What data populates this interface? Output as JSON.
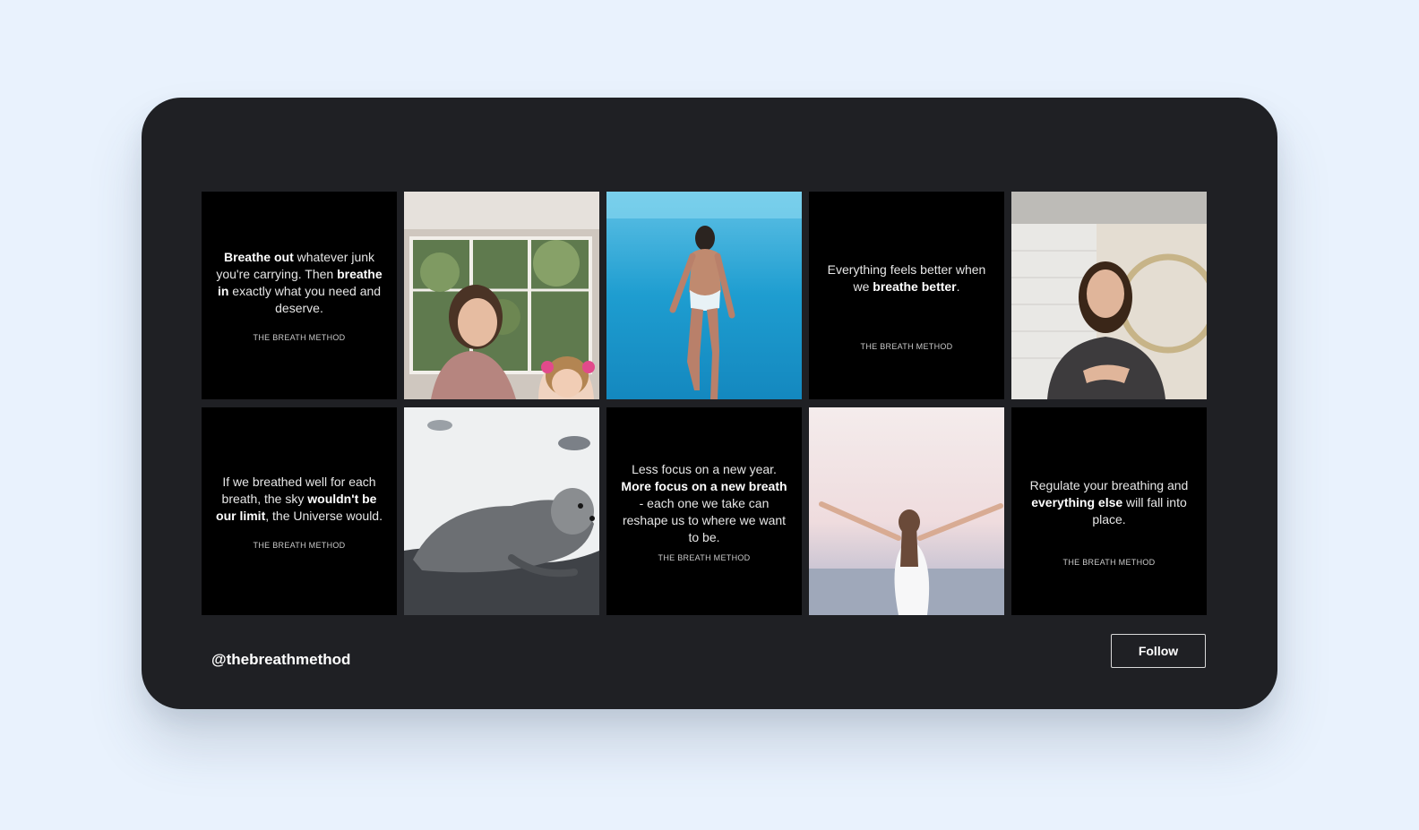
{
  "feed": {
    "handle": "@thebreathmethod",
    "follow_label": "Follow",
    "signature": "THE BREATH METHOD"
  },
  "tiles": [
    {
      "kind": "quote",
      "segments": [
        {
          "t": "Breathe out",
          "b": true
        },
        {
          "t": " whatever junk you're carrying. Then ",
          "b": false
        },
        {
          "t": "breathe in",
          "b": true
        },
        {
          "t": " exactly what you need and deserve.",
          "b": false
        }
      ]
    },
    {
      "kind": "photo",
      "subject": "woman-and-child-photo"
    },
    {
      "kind": "photo",
      "subject": "underwater-swimmer-photo"
    },
    {
      "kind": "quote",
      "segments": [
        {
          "t": "Everything feels better when we ",
          "b": false
        },
        {
          "t": "breathe better",
          "b": true
        },
        {
          "t": ".",
          "b": false
        }
      ]
    },
    {
      "kind": "photo",
      "subject": "woman-hand-on-chest-photo"
    },
    {
      "kind": "quote",
      "segments": [
        {
          "t": "If we breathed well for each breath, the sky ",
          "b": false
        },
        {
          "t": "wouldn't be our limit",
          "b": true
        },
        {
          "t": ", the Universe would.",
          "b": false
        }
      ]
    },
    {
      "kind": "photo",
      "subject": "seal-on-rocks-photo"
    },
    {
      "kind": "quote",
      "segments": [
        {
          "t": "Less focus on a new year. ",
          "b": false
        },
        {
          "t": "More focus on a new breath",
          "b": true
        },
        {
          "t": " - each one we take can reshape us to where we want to be.",
          "b": false
        }
      ]
    },
    {
      "kind": "photo",
      "subject": "arms-raised-sea-photo"
    },
    {
      "kind": "quote",
      "segments": [
        {
          "t": "Regulate your breathing and ",
          "b": false
        },
        {
          "t": "everything else",
          "b": true
        },
        {
          "t": " will fall into place.",
          "b": false
        }
      ]
    }
  ]
}
